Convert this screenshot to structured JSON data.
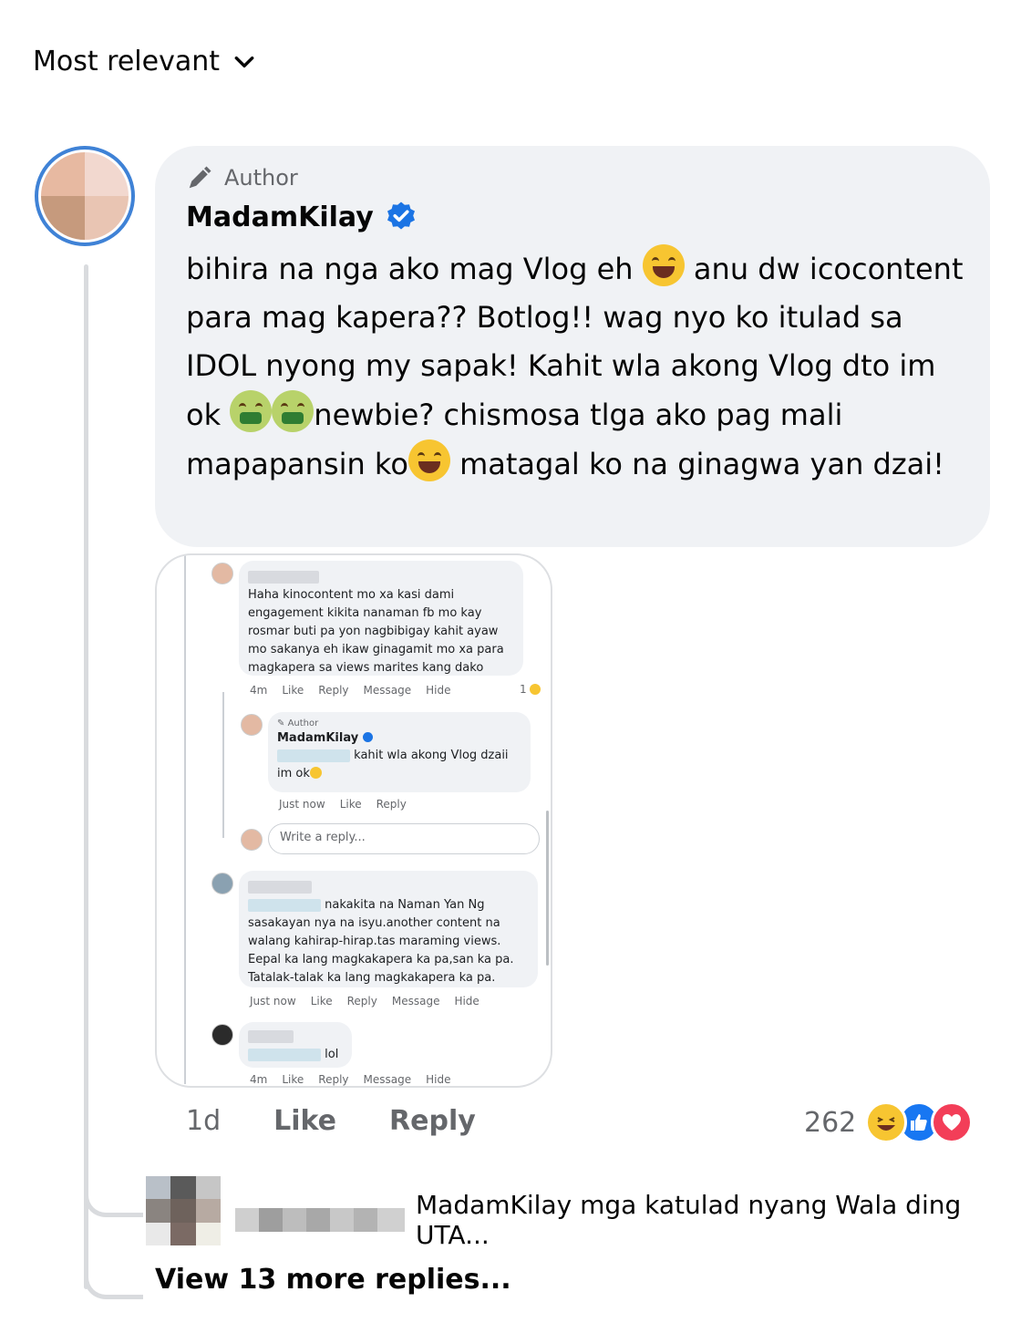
{
  "sort": {
    "label": "Most relevant"
  },
  "comment": {
    "author_badge": "Author",
    "name": "MadamKilay",
    "body": {
      "p1": "bihira na nga ako mag Vlog eh ",
      "p2": " anu dw icocontent para mag kapera?? Botlog!! wag nyo ko itulad sa IDOL nyong my sapak! Kahit wla akong Vlog dto im ok ",
      "p3": "newbie? chismosa tlga ako pag mali mapapansin ko",
      "p4": " matagal ko na ginagwa yan dzai!"
    },
    "emojis": [
      "laughing-tears-emoji",
      "money-mouth-emoji",
      "money-mouth-emoji",
      "laughing-tears-emoji"
    ],
    "time": "1d",
    "like_label": "Like",
    "reply_label": "Reply",
    "reaction_count": "262",
    "reactions": [
      "haha",
      "like",
      "love"
    ]
  },
  "screenshot": {
    "c1": {
      "text": "Haha kinocontent mo xa kasi dami engagement kikita nanaman fb mo kay rosmar buti pa yon nagbibigay kahit ayaw mo sakanya eh ikaw ginagamit mo xa para magkapera sa views marites kang dako",
      "time": "4m",
      "like": "Like",
      "reply": "Reply",
      "message": "Message",
      "hide": "Hide",
      "react_count": "1"
    },
    "c2": {
      "badge": "Author",
      "name": "MadamKilay",
      "text": "kahit wla akong Vlog dzaii",
      "text2": "im ok",
      "time": "Just now",
      "like": "Like",
      "reply": "Reply"
    },
    "write_reply": "Write a reply...",
    "c3": {
      "text1": "nakakita na Naman Yan Ng",
      "text": "sasakayan nya na isyu.another content na walang kahirap-hirap.tas maraming views. Eepal ka lang magkakapera ka pa,san ka pa. Tatalak-talak ka lang magkakapera ka pa.",
      "time": "Just now",
      "like": "Like",
      "reply": "Reply",
      "message": "Message",
      "hide": "Hide"
    },
    "c4": {
      "text": "lol",
      "time": "4m",
      "like": "Like",
      "reply": "Reply",
      "message": "Message",
      "hide": "Hide"
    }
  },
  "reply_preview": {
    "text": "MadamKilay mga katulad nyang Wala ding UTA..."
  },
  "view_more": "View 13 more replies..."
}
